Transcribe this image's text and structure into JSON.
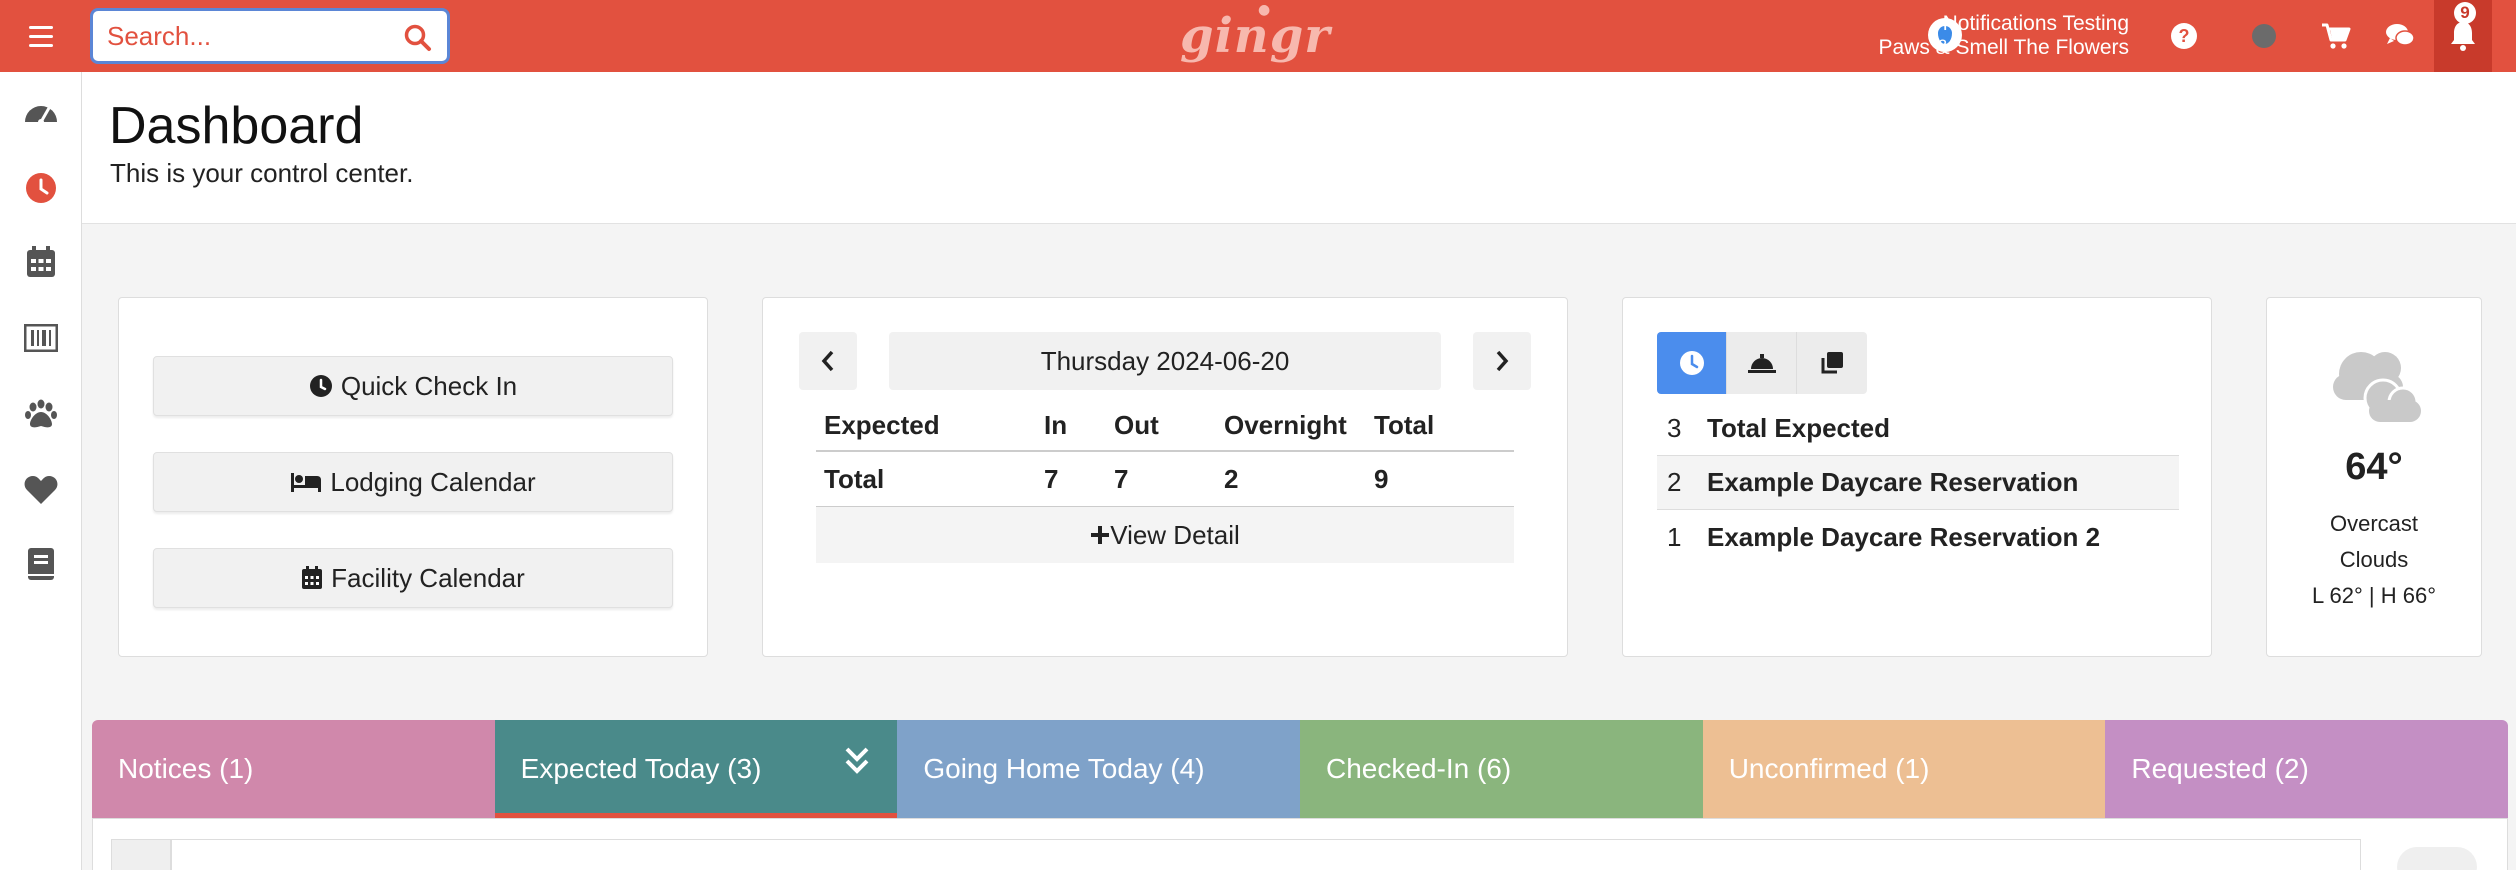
{
  "topbar": {
    "search_placeholder": "Search...",
    "logo_text": "gingr",
    "account_line1": "Notifications Testing",
    "account_line2": "Paws & Smell The Flowers",
    "notification_count": "9",
    "accent_color": "#e2513f"
  },
  "sidebar": {
    "items": [
      {
        "icon": "dashboard-gauge-icon"
      },
      {
        "icon": "clock-icon"
      },
      {
        "icon": "calendar-icon"
      },
      {
        "icon": "barcode-icon"
      },
      {
        "icon": "paw-icon"
      },
      {
        "icon": "heart-icon"
      },
      {
        "icon": "book-icon"
      }
    ]
  },
  "header": {
    "title": "Dashboard",
    "subtitle": "This is your control center."
  },
  "quick_actions": {
    "check_in": "Quick Check In",
    "lodging": "Lodging Calendar",
    "facility": "Facility Calendar"
  },
  "summary": {
    "date": "Thursday 2024-06-20",
    "columns": [
      "Expected",
      "In",
      "Out",
      "Overnight",
      "Total"
    ],
    "row": [
      "Total",
      "7",
      "7",
      "2",
      "9"
    ],
    "view_detail": "View Detail"
  },
  "reservations": {
    "rows": [
      {
        "count": "3",
        "label": "Total Expected"
      },
      {
        "count": "2",
        "label": "Example Daycare Reservation"
      },
      {
        "count": "1",
        "label": "Example Daycare Reservation 2"
      }
    ]
  },
  "weather": {
    "temp": "64°",
    "condition_line1": "Overcast",
    "condition_line2": "Clouds",
    "range": "L 62° | H 66°"
  },
  "tabs": [
    {
      "label": "Notices (1)",
      "color": "#d088ab"
    },
    {
      "label": "Expected Today (3)",
      "color": "#4a8a8a"
    },
    {
      "label": "Going Home Today (4)",
      "color": "#7fa2c9"
    },
    {
      "label": "Checked-In (6)",
      "color": "#8ab57d"
    },
    {
      "label": "Unconfirmed (1)",
      "color": "#edbf93"
    },
    {
      "label": "Requested (2)",
      "color": "#c48fc4"
    }
  ]
}
